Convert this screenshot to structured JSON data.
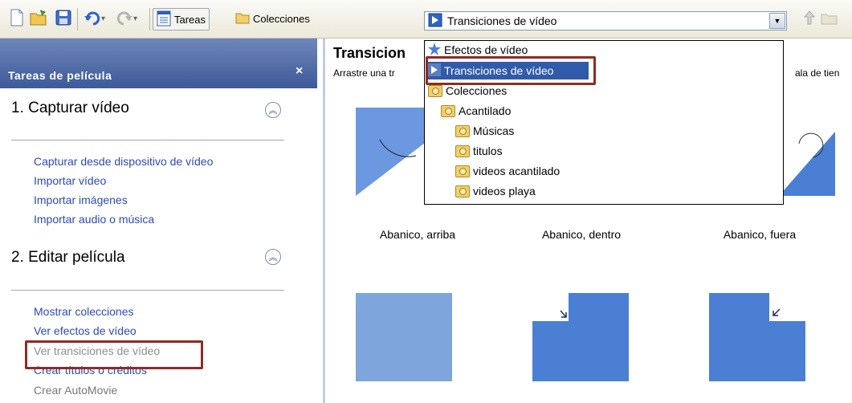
{
  "toolbar": {
    "tareas_label": "Tareas",
    "colecciones_label": "Colecciones",
    "combo_value": "Transiciones de vídeo"
  },
  "dropdown": {
    "items": [
      {
        "label": "Efectos de vídeo"
      },
      {
        "label": "Transiciones de vídeo"
      },
      {
        "label": "Colecciones"
      },
      {
        "label": "Acantilado"
      },
      {
        "label": "Músicas"
      },
      {
        "label": "titulos"
      },
      {
        "label": "videos acantilado"
      },
      {
        "label": "videos playa"
      }
    ]
  },
  "taskpane": {
    "title": "Tareas de película",
    "close": "×",
    "section1": {
      "title": "1. Capturar vídeo",
      "links": [
        "Capturar desde dispositivo de vídeo",
        "Importar vídeo",
        "Importar imágenes",
        "Importar audio o música"
      ]
    },
    "section2": {
      "title": "2. Editar película",
      "links": [
        "Mostrar colecciones",
        "Ver efectos de vídeo",
        "Ver transiciones de vídeo",
        "Crear títulos o créditos",
        "Crear AutoMovie"
      ]
    }
  },
  "content": {
    "title": "Transicion",
    "subtitle": "Arrastre una tr",
    "subtitle_right": "ala de tien",
    "thumbs": [
      "Abanico, arriba",
      "Abanico, dentro",
      "Abanico, fuera"
    ]
  },
  "colors": {
    "accent": "#305ba8",
    "highlight_border": "#8e2b26",
    "link": "#2b4ab9",
    "thumb_blue": "#4a7fd4"
  }
}
